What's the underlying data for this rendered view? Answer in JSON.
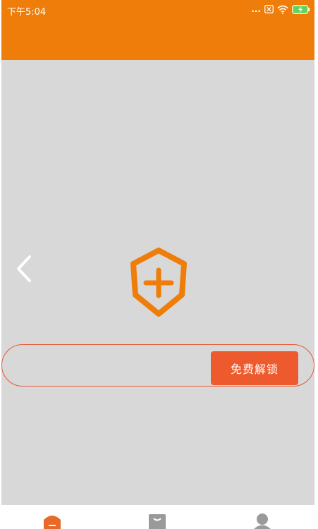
{
  "status_bar": {
    "time": "下午5:04",
    "dots": "...",
    "icons": [
      "sim-icon",
      "wifi-icon",
      "battery-charging-icon"
    ]
  },
  "colors": {
    "header": "#ef7d0a",
    "background": "#d8d8d8",
    "accent": "#ed5a2e",
    "icon_orange": "#ef7d0a",
    "nav_active": "#e8692a",
    "nav_inactive": "#9a9a9a"
  },
  "main": {
    "center_icon": "shield-plus-icon",
    "back_icon": "chevron-left-icon"
  },
  "unlock": {
    "button_label": "免费解锁"
  },
  "bottom_nav": {
    "items": [
      {
        "icon": "home-icon",
        "active": true
      },
      {
        "icon": "bag-icon",
        "active": false
      },
      {
        "icon": "user-icon",
        "active": false
      }
    ]
  }
}
